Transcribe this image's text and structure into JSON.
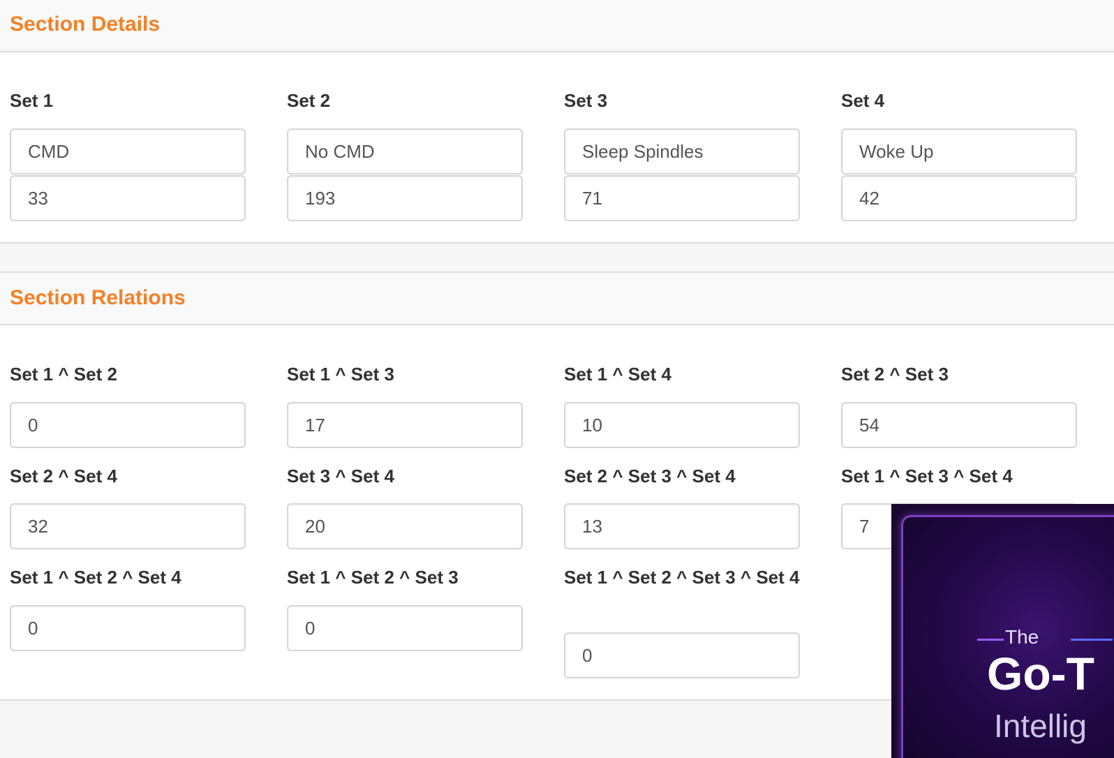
{
  "details": {
    "title": "Section Details",
    "sets": [
      {
        "label": "Set 1",
        "name": "CMD",
        "count": "33"
      },
      {
        "label": "Set 2",
        "name": "No CMD",
        "count": "193"
      },
      {
        "label": "Set 3",
        "name": "Sleep Spindles",
        "count": "71"
      },
      {
        "label": "Set 4",
        "name": "Woke Up",
        "count": "42"
      }
    ]
  },
  "relations": {
    "title": "Section Relations",
    "items": [
      {
        "label": "Set 1 ^ Set 2",
        "value": "0"
      },
      {
        "label": "Set 1 ^ Set 3",
        "value": "17"
      },
      {
        "label": "Set 1 ^ Set 4",
        "value": "10"
      },
      {
        "label": "Set 2 ^ Set 3",
        "value": "54"
      },
      {
        "label": "Set 2 ^ Set 4",
        "value": "32"
      },
      {
        "label": "Set 3 ^ Set 4",
        "value": "20"
      },
      {
        "label": "Set 2 ^ Set 3 ^ Set 4",
        "value": "13"
      },
      {
        "label": "Set 1 ^ Set 3 ^ Set 4",
        "value": "7"
      },
      {
        "label": "Set 1 ^ Set 2 ^ Set 4",
        "value": "0"
      },
      {
        "label": "Set 1 ^ Set 2 ^ Set 3",
        "value": "0"
      },
      {
        "label": "Set 1 ^ Set 2 ^ Set 3 ^ Set 4",
        "value": "0"
      }
    ]
  },
  "ad": {
    "kicker": "The",
    "headline": "Go-T",
    "subline": "Intellig"
  }
}
